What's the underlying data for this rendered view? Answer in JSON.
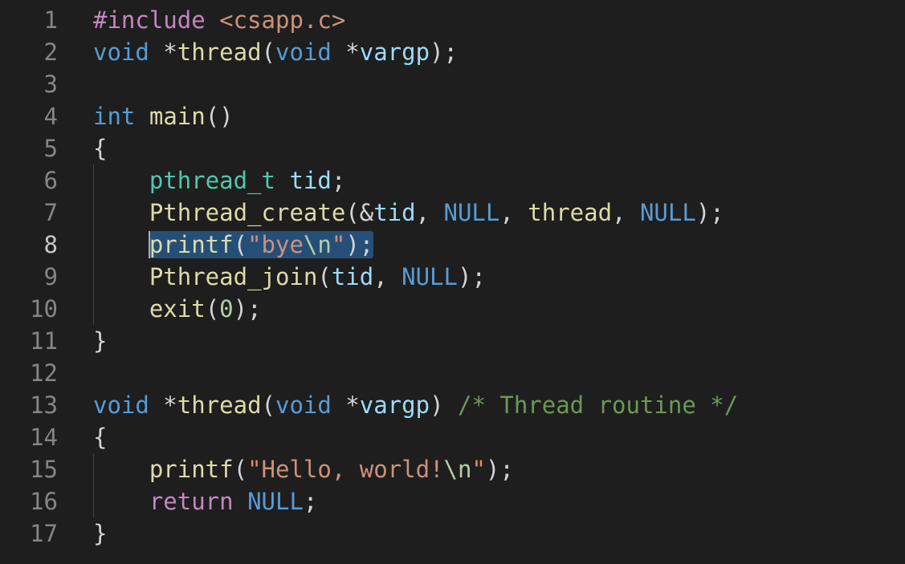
{
  "editor": {
    "active_line": 8,
    "colors": {
      "background": "#1e1e1e",
      "line_number": "#858585",
      "line_number_active": "#c6c6c6",
      "selection": "#264f78",
      "keyword": "#569cd6",
      "control": "#c586c0",
      "function": "#dcdcaa",
      "type": "#4ec9b0",
      "variable": "#9cdcfe",
      "string": "#ce9178",
      "number": "#b5cea8",
      "comment": "#6a9955",
      "plain": "#d4d4d4"
    },
    "lines": [
      {
        "num": "1",
        "tokens": [
          {
            "t": "#include ",
            "c": "control"
          },
          {
            "t": "<csapp.c>",
            "c": "string"
          }
        ]
      },
      {
        "num": "2",
        "tokens": [
          {
            "t": "void",
            "c": "keyword"
          },
          {
            "t": " *",
            "c": "plain"
          },
          {
            "t": "thread",
            "c": "function"
          },
          {
            "t": "(",
            "c": "plain"
          },
          {
            "t": "void",
            "c": "keyword"
          },
          {
            "t": " *",
            "c": "plain"
          },
          {
            "t": "vargp",
            "c": "variable"
          },
          {
            "t": ");",
            "c": "plain"
          }
        ]
      },
      {
        "num": "3",
        "tokens": []
      },
      {
        "num": "4",
        "tokens": [
          {
            "t": "int",
            "c": "keyword"
          },
          {
            "t": " ",
            "c": "plain"
          },
          {
            "t": "main",
            "c": "function"
          },
          {
            "t": "()",
            "c": "plain"
          }
        ]
      },
      {
        "num": "5",
        "tokens": [
          {
            "t": "{",
            "c": "plain"
          }
        ]
      },
      {
        "num": "6",
        "tokens": [
          {
            "t": "    ",
            "c": "plain"
          },
          {
            "t": "pthread_t",
            "c": "type"
          },
          {
            "t": " ",
            "c": "plain"
          },
          {
            "t": "tid",
            "c": "variable"
          },
          {
            "t": ";",
            "c": "plain"
          }
        ]
      },
      {
        "num": "7",
        "tokens": [
          {
            "t": "    ",
            "c": "plain"
          },
          {
            "t": "Pthread_create",
            "c": "function"
          },
          {
            "t": "(&",
            "c": "plain"
          },
          {
            "t": "tid",
            "c": "variable"
          },
          {
            "t": ", ",
            "c": "plain"
          },
          {
            "t": "NULL",
            "c": "keyword"
          },
          {
            "t": ", ",
            "c": "plain"
          },
          {
            "t": "thread",
            "c": "function"
          },
          {
            "t": ", ",
            "c": "plain"
          },
          {
            "t": "NULL",
            "c": "keyword"
          },
          {
            "t": ");",
            "c": "plain"
          }
        ]
      },
      {
        "num": "8",
        "tokens": [
          {
            "t": "    ",
            "c": "plain"
          },
          {
            "t": "printf",
            "c": "function",
            "sel": true
          },
          {
            "t": "(",
            "c": "plain",
            "sel": true
          },
          {
            "t": "\"bye",
            "c": "string",
            "sel": true
          },
          {
            "t": "\\n",
            "c": "number",
            "sel": true
          },
          {
            "t": "\"",
            "c": "string",
            "sel": true
          },
          {
            "t": ");",
            "c": "plain",
            "sel": true
          }
        ]
      },
      {
        "num": "9",
        "tokens": [
          {
            "t": "    ",
            "c": "plain"
          },
          {
            "t": "Pthread_join",
            "c": "function"
          },
          {
            "t": "(",
            "c": "plain"
          },
          {
            "t": "tid",
            "c": "variable"
          },
          {
            "t": ", ",
            "c": "plain"
          },
          {
            "t": "NULL",
            "c": "keyword"
          },
          {
            "t": ");",
            "c": "plain"
          }
        ]
      },
      {
        "num": "10",
        "tokens": [
          {
            "t": "    ",
            "c": "plain"
          },
          {
            "t": "exit",
            "c": "function"
          },
          {
            "t": "(",
            "c": "plain"
          },
          {
            "t": "0",
            "c": "number"
          },
          {
            "t": ");",
            "c": "plain"
          }
        ]
      },
      {
        "num": "11",
        "tokens": [
          {
            "t": "}",
            "c": "plain"
          }
        ]
      },
      {
        "num": "12",
        "tokens": []
      },
      {
        "num": "13",
        "tokens": [
          {
            "t": "void",
            "c": "keyword"
          },
          {
            "t": " *",
            "c": "plain"
          },
          {
            "t": "thread",
            "c": "function"
          },
          {
            "t": "(",
            "c": "plain"
          },
          {
            "t": "void",
            "c": "keyword"
          },
          {
            "t": " *",
            "c": "plain"
          },
          {
            "t": "vargp",
            "c": "variable"
          },
          {
            "t": ") ",
            "c": "plain"
          },
          {
            "t": "/* Thread routine */",
            "c": "comment"
          }
        ]
      },
      {
        "num": "14",
        "tokens": [
          {
            "t": "{",
            "c": "plain"
          }
        ]
      },
      {
        "num": "15",
        "tokens": [
          {
            "t": "    ",
            "c": "plain"
          },
          {
            "t": "printf",
            "c": "function"
          },
          {
            "t": "(",
            "c": "plain"
          },
          {
            "t": "\"Hello, world!",
            "c": "string"
          },
          {
            "t": "\\n",
            "c": "number"
          },
          {
            "t": "\"",
            "c": "string"
          },
          {
            "t": ");",
            "c": "plain"
          }
        ]
      },
      {
        "num": "16",
        "tokens": [
          {
            "t": "    ",
            "c": "plain"
          },
          {
            "t": "return",
            "c": "control"
          },
          {
            "t": " ",
            "c": "plain"
          },
          {
            "t": "NULL",
            "c": "keyword"
          },
          {
            "t": ";",
            "c": "plain"
          }
        ]
      },
      {
        "num": "17",
        "tokens": [
          {
            "t": "}",
            "c": "plain"
          }
        ]
      }
    ]
  }
}
